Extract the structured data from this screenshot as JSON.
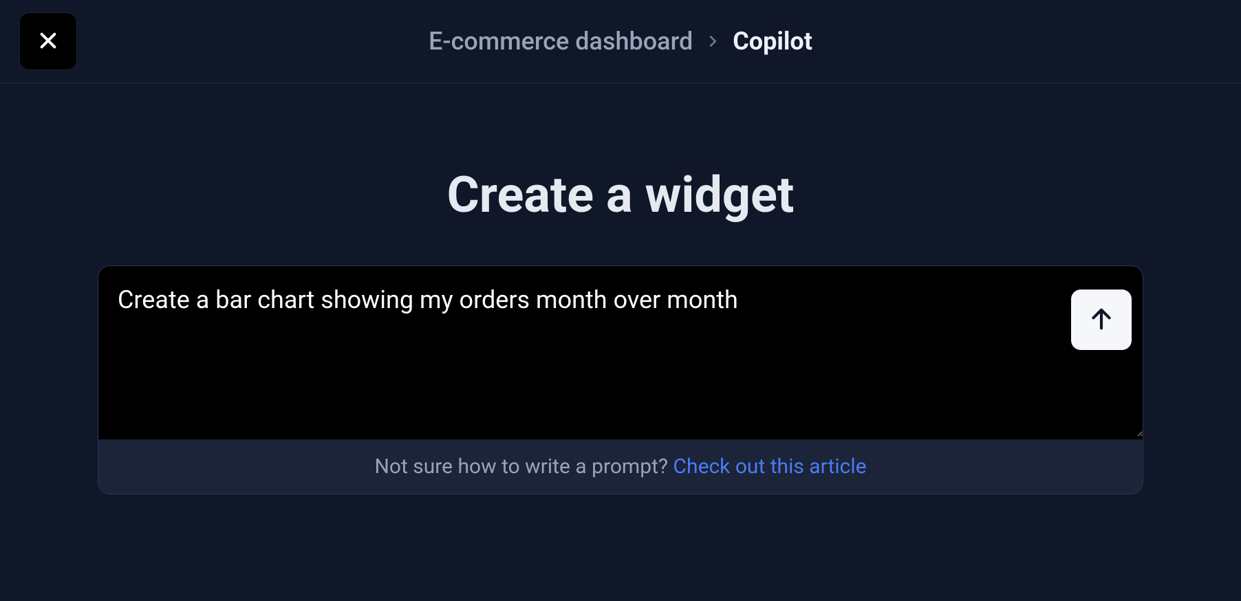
{
  "breadcrumb": {
    "parent": "E-commerce dashboard",
    "current": "Copilot"
  },
  "main": {
    "title": "Create a widget",
    "prompt_value": "Create a bar chart showing my orders month over month",
    "prompt_placeholder": "",
    "footer_text": "Not sure how to write a prompt? ",
    "footer_link": "Check out this article"
  }
}
